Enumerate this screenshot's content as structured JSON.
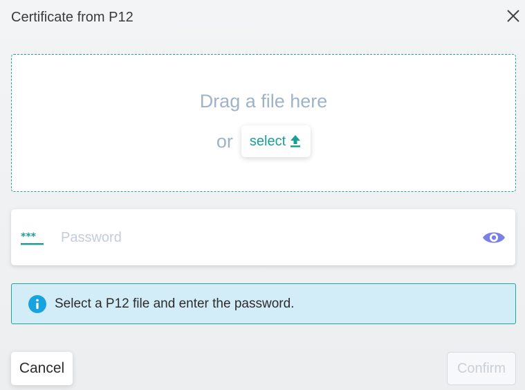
{
  "dialog": {
    "title": "Certificate from P12",
    "close_icon": "close-icon"
  },
  "dropzone": {
    "drag_text": "Drag a file here",
    "or_text": "or",
    "select_label": "select",
    "select_icon": "upload-icon",
    "border_color": "#21a29a"
  },
  "password": {
    "placeholder": "Password",
    "value": "",
    "leading_icon": "password-asterisks-icon",
    "toggle_icon": "eye-icon",
    "toggle_color": "#7b80e3"
  },
  "info": {
    "icon": "info-icon",
    "message": "Select a P12 file and enter the password.",
    "background": "#d2ecf8"
  },
  "actions": {
    "cancel_label": "Cancel",
    "confirm_label": "Confirm",
    "confirm_disabled": true
  },
  "colors": {
    "accent": "#1a9f94",
    "info_icon": "#16a3e0"
  }
}
